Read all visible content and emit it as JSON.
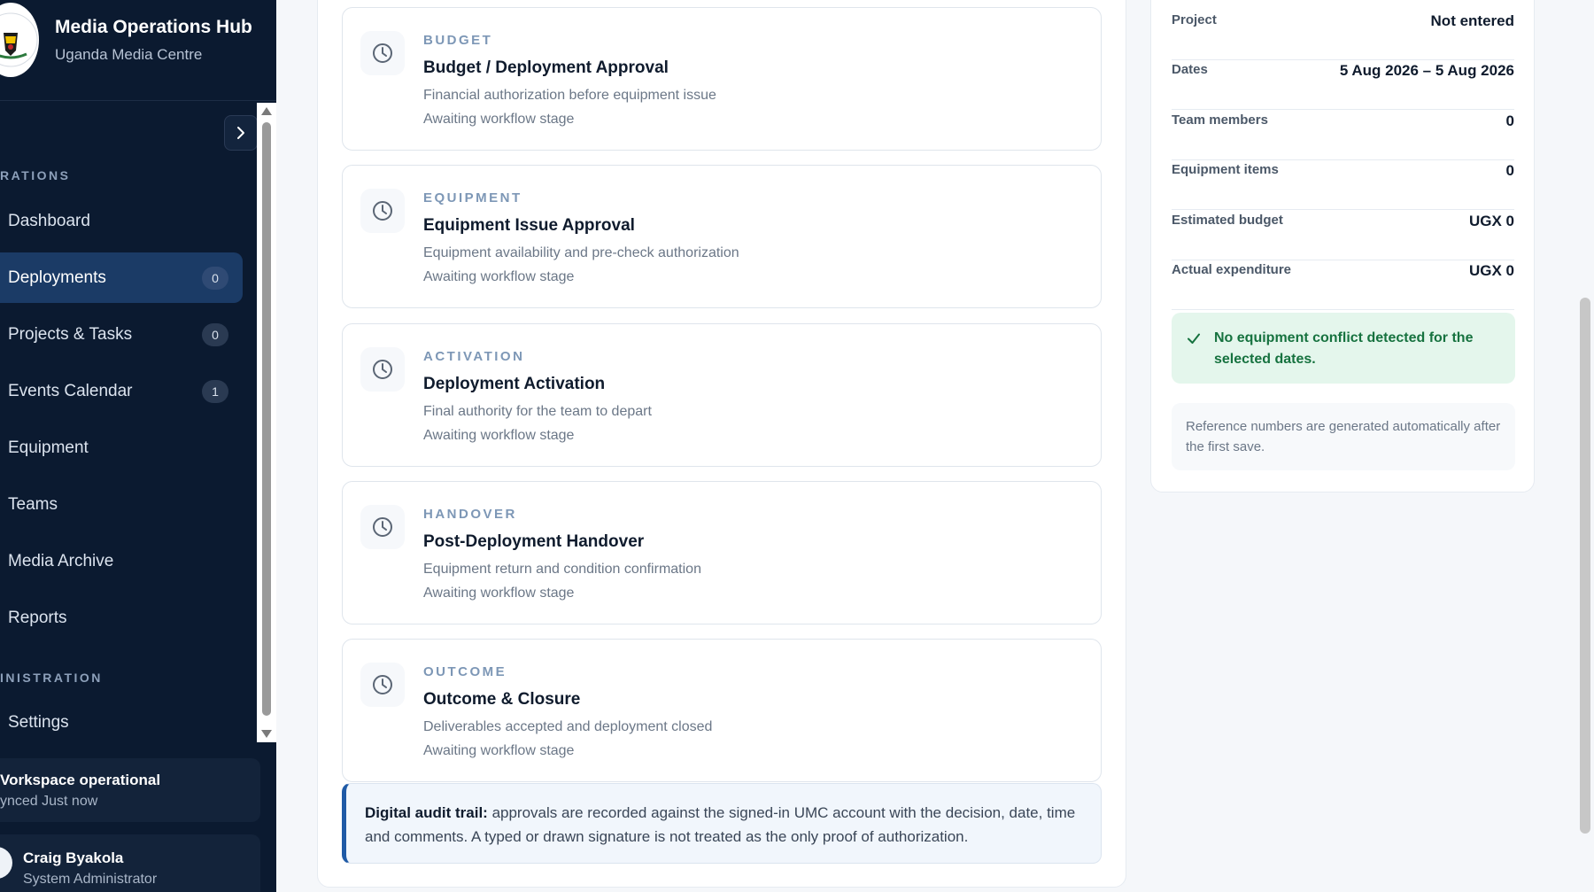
{
  "sidebar": {
    "brand_title": "Media Operations Hub",
    "brand_subtitle": "Uganda Media Centre",
    "section_operations": "RATIONS",
    "section_administration": "INISTRATION",
    "items": [
      {
        "label": "Dashboard",
        "badge": ""
      },
      {
        "label": "Deployments",
        "badge": "0"
      },
      {
        "label": "Projects & Tasks",
        "badge": "0"
      },
      {
        "label": "Events Calendar",
        "badge": "1"
      },
      {
        "label": "Equipment",
        "badge": ""
      },
      {
        "label": "Teams",
        "badge": ""
      },
      {
        "label": "Media Archive",
        "badge": ""
      },
      {
        "label": "Reports",
        "badge": ""
      },
      {
        "label": "Settings",
        "badge": ""
      }
    ],
    "status_title": "Vorkspace operational",
    "status_sub": "ynced Just now",
    "user_name": "Craig Byakola",
    "user_role": "System Administrator"
  },
  "stages": [
    {
      "tag": "BUDGET",
      "title": "Budget / Deployment Approval",
      "desc": "Financial authorization before equipment issue",
      "status": "Awaiting workflow stage"
    },
    {
      "tag": "EQUIPMENT",
      "title": "Equipment Issue Approval",
      "desc": "Equipment availability and pre-check authorization",
      "status": "Awaiting workflow stage"
    },
    {
      "tag": "ACTIVATION",
      "title": "Deployment Activation",
      "desc": "Final authority for the team to depart",
      "status": "Awaiting workflow stage"
    },
    {
      "tag": "HANDOVER",
      "title": "Post-Deployment Handover",
      "desc": "Equipment return and condition confirmation",
      "status": "Awaiting workflow stage"
    },
    {
      "tag": "OUTCOME",
      "title": "Outcome & Closure",
      "desc": "Deliverables accepted and deployment closed",
      "status": "Awaiting workflow stage"
    }
  ],
  "audit": {
    "label": "Digital audit trail:",
    "text": " approvals are recorded against the signed-in UMC account with the decision, date, time and comments. A typed or drawn signature is not treated as the only proof of authorization."
  },
  "summary": {
    "rows": [
      {
        "label": "Project",
        "value": "Not entered"
      },
      {
        "label": "Dates",
        "value": "5 Aug 2026 – 5 Aug 2026"
      },
      {
        "label": "Team members",
        "value": "0"
      },
      {
        "label": "Equipment items",
        "value": "0"
      },
      {
        "label": "Estimated budget",
        "value": "UGX 0"
      },
      {
        "label": "Actual expenditure",
        "value": "UGX 0"
      }
    ],
    "conflict_text": "No equipment conflict detected for the selected dates.",
    "reference_note": "Reference numbers are generated automatically after the first save."
  },
  "colors": {
    "sidebar_bg": "#0b1a30",
    "active_nav": "#1b3b66",
    "accent_blue": "#1f5aa6",
    "success_text": "#16723f",
    "success_bg": "#e4f6ec"
  }
}
